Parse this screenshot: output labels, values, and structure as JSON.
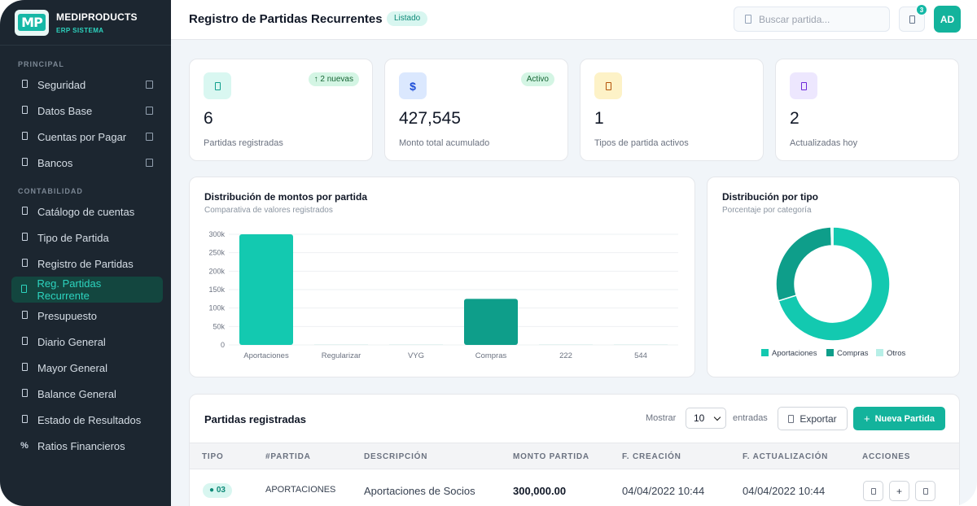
{
  "brand": {
    "name": "MEDIPRODUCTS",
    "subtitle": "ERP SISTEMA",
    "logo_text": "MP"
  },
  "sidebar": {
    "sections": [
      {
        "label": "PRINCIPAL",
        "items": [
          {
            "label": "Seguridad",
            "icon": "shield-icon",
            "expandable": true
          },
          {
            "label": "Datos Base",
            "icon": "database-icon",
            "expandable": true
          },
          {
            "label": "Cuentas por Pagar",
            "icon": "wallet-icon",
            "expandable": true
          },
          {
            "label": "Bancos",
            "icon": "bank-icon",
            "expandable": true
          }
        ]
      },
      {
        "label": "CONTABILIDAD",
        "items": [
          {
            "label": "Catálogo de cuentas",
            "icon": "catalog-icon"
          },
          {
            "label": "Tipo de Partida",
            "icon": "tag-icon"
          },
          {
            "label": "Registro de Partidas",
            "icon": "ledger-icon"
          },
          {
            "label": "Reg. Partidas Recurrente",
            "icon": "repeat-icon",
            "active": true
          },
          {
            "label": "Presupuesto",
            "icon": "budget-icon"
          },
          {
            "label": "Diario General",
            "icon": "journal-icon"
          },
          {
            "label": "Mayor General",
            "icon": "book-icon"
          },
          {
            "label": "Balance General",
            "icon": "balance-icon"
          },
          {
            "label": "Estado de Resultados",
            "icon": "report-icon"
          },
          {
            "label": "Ratios Financieros",
            "icon": "percent-icon",
            "glyph": "%"
          }
        ]
      }
    ]
  },
  "header": {
    "title": "Registro de Partidas Recurrentes",
    "badge": "Listado",
    "search_placeholder": "Buscar partida...",
    "notifications": "3",
    "avatar": "AD"
  },
  "stats": [
    {
      "value": "6",
      "label": "Partidas registradas",
      "pill": "↑ 2 nuevas",
      "icon": "document-icon",
      "icon_bg": "#d9f7f1",
      "icon_color": "#0f9f8c"
    },
    {
      "value": "427,545",
      "label": "Monto total acumulado",
      "pill": "Activo",
      "icon": "dollar-icon",
      "glyph": "$",
      "icon_bg": "#dbe8fe",
      "icon_color": "#1d4ed8"
    },
    {
      "value": "1",
      "label": "Tipos de partida activos",
      "icon": "folder-icon",
      "icon_bg": "#fdf2c7",
      "icon_color": "#b45309"
    },
    {
      "value": "2",
      "label": "Actualizadas hoy",
      "icon": "calendar-icon",
      "icon_bg": "#ede7fe",
      "icon_color": "#6d28d9"
    }
  ],
  "bar_card": {
    "title": "Distribución de montos por partida",
    "subtitle": "Comparativa de valores registrados"
  },
  "donut_card": {
    "title": "Distribución por tipo",
    "subtitle": "Porcentaje por categoría"
  },
  "chart_data": [
    {
      "type": "bar",
      "title": "Distribución de montos por partida",
      "subtitle": "Comparativa de valores registrados",
      "categories": [
        "Aportaciones",
        "Regularizar",
        "VYG",
        "Compras",
        "222",
        "544"
      ],
      "values": [
        300000,
        0,
        0,
        125000,
        0,
        0
      ],
      "colors": [
        "#13c9b0",
        "#13c9b0",
        "#13c9b0",
        "#0e9e8a",
        "#13c9b0",
        "#13c9b0"
      ],
      "yticks": [
        "300k",
        "250k",
        "200k",
        "150k",
        "100k",
        "50k",
        "0"
      ],
      "ylim": [
        0,
        300000
      ],
      "grid": true
    },
    {
      "type": "pie",
      "title": "Distribución por tipo",
      "subtitle": "Porcentaje por categoría",
      "categories": [
        "Aportaciones",
        "Compras",
        "Otros"
      ],
      "values": [
        70.2,
        29.3,
        0.5
      ],
      "colors": [
        "#13c9b0",
        "#0e9e8a",
        "#b7efe7"
      ],
      "legend": "bottom"
    }
  ],
  "table": {
    "title": "Partidas registradas",
    "show_label": "Mostrar",
    "page_size": "10",
    "entries_label": "entradas",
    "export_label": "Exportar",
    "new_label": "Nueva Partida",
    "columns": [
      "TIPO",
      "#PARTIDA",
      "DESCRIPCIÓN",
      "MONTO PARTIDA",
      "F. CREACIÓN",
      "F. ACTUALIZACIÓN",
      "ACCIONES"
    ],
    "rows": [
      {
        "tipo": "● 03",
        "partida": "APORTACIONES",
        "descripcion": "Aportaciones de Socios",
        "monto": "300,000.00",
        "creacion": "04/04/2022 10:44",
        "actualizacion": "04/04/2022 10:44",
        "actions": [
          "view-icon",
          "+",
          "delete-icon"
        ]
      }
    ]
  }
}
